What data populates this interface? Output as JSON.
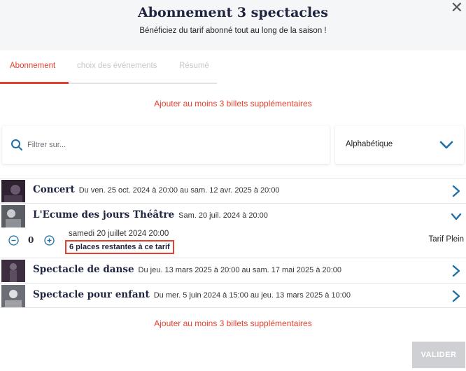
{
  "header": {
    "title": "Abonnement 3 spectacles",
    "subtitle": "Bénéficiez du tarif abonné tout au long de la saison !",
    "close_icon": "close-icon"
  },
  "tabs": [
    {
      "label": "Abonnement",
      "active": true
    },
    {
      "label": "choix des événements",
      "active": false
    },
    {
      "label": "Résumé",
      "active": false
    }
  ],
  "warning_top": "Ajouter au moins 3 billets supplémentaires",
  "filter": {
    "placeholder": "Filtrer sur...",
    "sort_value": "Alphabétique"
  },
  "events": [
    {
      "name": "Concert",
      "dates": "Du ven. 25 oct. 2024 à 20:00 au sam. 12 avr. 2025 à 20:00",
      "expanded": false
    },
    {
      "name": "L'Ecume des jours Théâtre",
      "dates": "Sam. 20 juil. 2024 à 20:00",
      "expanded": true
    },
    {
      "name": "Spectacle de danse",
      "dates": "Du jeu. 13 mars 2025 à 20:00 au sam. 17 mai 2025 à 20:00",
      "expanded": false
    },
    {
      "name": "Spectacle pour enfant",
      "dates": "Du mer. 5 juin 2024 à 15:00 au jeu. 13 mars 2025 à 10:00",
      "expanded": false
    }
  ],
  "session": {
    "date": "samedi 20 juillet 2024 20:00",
    "remaining": "6 places restantes à ce tarif",
    "quantity": "0",
    "tarif": "Tarif Plein"
  },
  "warning_bottom": "Ajouter au moins 3 billets supplémentaires",
  "validate_label": "VALIDER",
  "colors": {
    "accent": "#e4402f",
    "navy": "#1f2440",
    "disabled": "#cfd0d4"
  }
}
